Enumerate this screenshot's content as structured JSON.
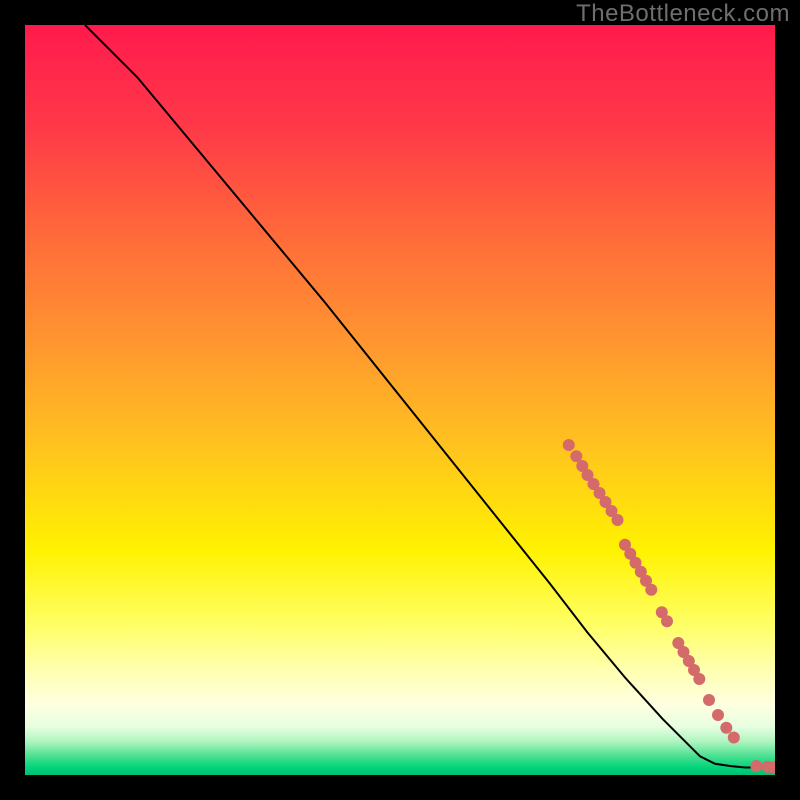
{
  "watermark": "TheBottleneck.com",
  "chart_data": {
    "type": "line",
    "title": "",
    "xlabel": "",
    "ylabel": "",
    "xlim": [
      0,
      100
    ],
    "ylim": [
      0,
      100
    ],
    "grid": false,
    "series": [
      {
        "name": "curve",
        "x": [
          8,
          10,
          12,
          15,
          20,
          30,
          40,
          50,
          60,
          70,
          75,
          80,
          85,
          90,
          92,
          94,
          96,
          98,
          100
        ],
        "y": [
          100,
          98,
          96,
          93,
          87,
          75,
          63,
          50.5,
          38,
          25.5,
          19,
          13,
          7.5,
          2.5,
          1.5,
          1.2,
          1.0,
          1.0,
          1.0
        ]
      }
    ],
    "markers": [
      {
        "x": 72.5,
        "y": 44.0
      },
      {
        "x": 73.5,
        "y": 42.5
      },
      {
        "x": 74.3,
        "y": 41.2
      },
      {
        "x": 75.0,
        "y": 40.0
      },
      {
        "x": 75.8,
        "y": 38.8
      },
      {
        "x": 76.6,
        "y": 37.6
      },
      {
        "x": 77.4,
        "y": 36.4
      },
      {
        "x": 78.2,
        "y": 35.2
      },
      {
        "x": 79.0,
        "y": 34.0
      },
      {
        "x": 80.0,
        "y": 30.7
      },
      {
        "x": 80.7,
        "y": 29.5
      },
      {
        "x": 81.4,
        "y": 28.3
      },
      {
        "x": 82.1,
        "y": 27.1
      },
      {
        "x": 82.8,
        "y": 25.9
      },
      {
        "x": 83.5,
        "y": 24.7
      },
      {
        "x": 84.9,
        "y": 21.7
      },
      {
        "x": 85.6,
        "y": 20.5
      },
      {
        "x": 87.1,
        "y": 17.6
      },
      {
        "x": 87.8,
        "y": 16.4
      },
      {
        "x": 88.5,
        "y": 15.2
      },
      {
        "x": 89.2,
        "y": 14.0
      },
      {
        "x": 89.9,
        "y": 12.8
      },
      {
        "x": 91.2,
        "y": 10.0
      },
      {
        "x": 92.4,
        "y": 8.0
      },
      {
        "x": 93.5,
        "y": 6.3
      },
      {
        "x": 94.5,
        "y": 5.0
      },
      {
        "x": 97.5,
        "y": 1.2
      },
      {
        "x": 99.0,
        "y": 1.1
      },
      {
        "x": 99.7,
        "y": 1.0
      }
    ],
    "gradient_stops": [
      {
        "offset": 0.0,
        "color": "#ff1a4d"
      },
      {
        "offset": 0.14,
        "color": "#ff3a48"
      },
      {
        "offset": 0.28,
        "color": "#ff6a3a"
      },
      {
        "offset": 0.42,
        "color": "#ff9530"
      },
      {
        "offset": 0.56,
        "color": "#ffc21f"
      },
      {
        "offset": 0.7,
        "color": "#fff200"
      },
      {
        "offset": 0.8,
        "color": "#ffff66"
      },
      {
        "offset": 0.86,
        "color": "#ffffb0"
      },
      {
        "offset": 0.905,
        "color": "#ffffe0"
      },
      {
        "offset": 0.935,
        "color": "#e8ffe0"
      },
      {
        "offset": 0.955,
        "color": "#b0f5c0"
      },
      {
        "offset": 0.975,
        "color": "#4ae090"
      },
      {
        "offset": 0.99,
        "color": "#00d47a"
      },
      {
        "offset": 1.0,
        "color": "#00c074"
      }
    ],
    "marker_color": "#d46a6a",
    "line_color": "#000000"
  }
}
